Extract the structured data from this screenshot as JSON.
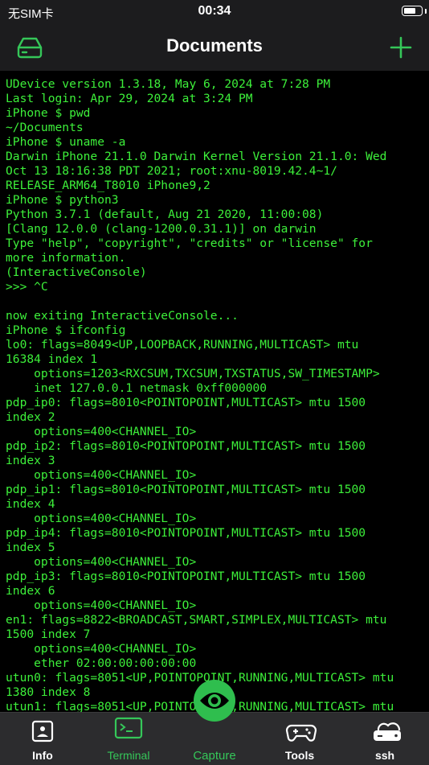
{
  "status_bar": {
    "carrier": "无SIM卡",
    "time": "00:34",
    "battery_level": 0.75
  },
  "nav": {
    "title": "Documents",
    "left_icon": "drive-icon",
    "right_icon": "plus-icon"
  },
  "terminal": {
    "lines": [
      "UDevice version 1.3.18, May 6, 2024 at 7:28 PM",
      "Last login: Apr 29, 2024 at 3:24 PM",
      "iPhone $ pwd",
      "~/Documents",
      "iPhone $ uname -a",
      "Darwin iPhone 21.1.0 Darwin Kernel Version 21.1.0: Wed",
      "Oct 13 18:16:38 PDT 2021; root:xnu-8019.42.4~1/",
      "RELEASE_ARM64_T8010 iPhone9,2",
      "iPhone $ python3",
      "Python 3.7.1 (default, Aug 21 2020, 11:00:08)",
      "[Clang 12.0.0 (clang-1200.0.31.1)] on darwin",
      "Type \"help\", \"copyright\", \"credits\" or \"license\" for",
      "more information.",
      "(InteractiveConsole)",
      ">>> ^C",
      "",
      "now exiting InteractiveConsole...",
      "iPhone $ ifconfig",
      "lo0: flags=8049<UP,LOOPBACK,RUNNING,MULTICAST> mtu",
      "16384 index 1",
      "    options=1203<RXCSUM,TXCSUM,TXSTATUS,SW_TIMESTAMP>",
      "    inet 127.0.0.1 netmask 0xff000000",
      "pdp_ip0: flags=8010<POINTOPOINT,MULTICAST> mtu 1500",
      "index 2",
      "    options=400<CHANNEL_IO>",
      "pdp_ip2: flags=8010<POINTOPOINT,MULTICAST> mtu 1500",
      "index 3",
      "    options=400<CHANNEL_IO>",
      "pdp_ip1: flags=8010<POINTOPOINT,MULTICAST> mtu 1500",
      "index 4",
      "    options=400<CHANNEL_IO>",
      "pdp_ip4: flags=8010<POINTOPOINT,MULTICAST> mtu 1500",
      "index 5",
      "    options=400<CHANNEL_IO>",
      "pdp_ip3: flags=8010<POINTOPOINT,MULTICAST> mtu 1500",
      "index 6",
      "    options=400<CHANNEL_IO>",
      "en1: flags=8822<BROADCAST,SMART,SIMPLEX,MULTICAST> mtu",
      "1500 index 7",
      "    options=400<CHANNEL_IO>",
      "    ether 02:00:00:00:00:00",
      "utun0: flags=8051<UP,POINTOPOINT,RUNNING,MULTICAST> mtu",
      "1380 index 8",
      "utun1: flags=8051<UP,POINTOPOINT,RUNNING,MULTICAST> mtu"
    ]
  },
  "tabs": [
    {
      "label": "Info",
      "icon": "info-icon"
    },
    {
      "label": "Terminal",
      "icon": "terminal-icon",
      "active": true
    },
    {
      "label": "Capture",
      "icon": "eye-icon"
    },
    {
      "label": "Tools",
      "icon": "gamepad-icon"
    },
    {
      "label": "ssh",
      "icon": "cloud-drive-icon"
    }
  ],
  "colors": {
    "accent": "#35c759",
    "terminal_text": "#3df03a",
    "bar_bg": "#1c1c1e",
    "tab_bg": "#2c2c2e"
  }
}
